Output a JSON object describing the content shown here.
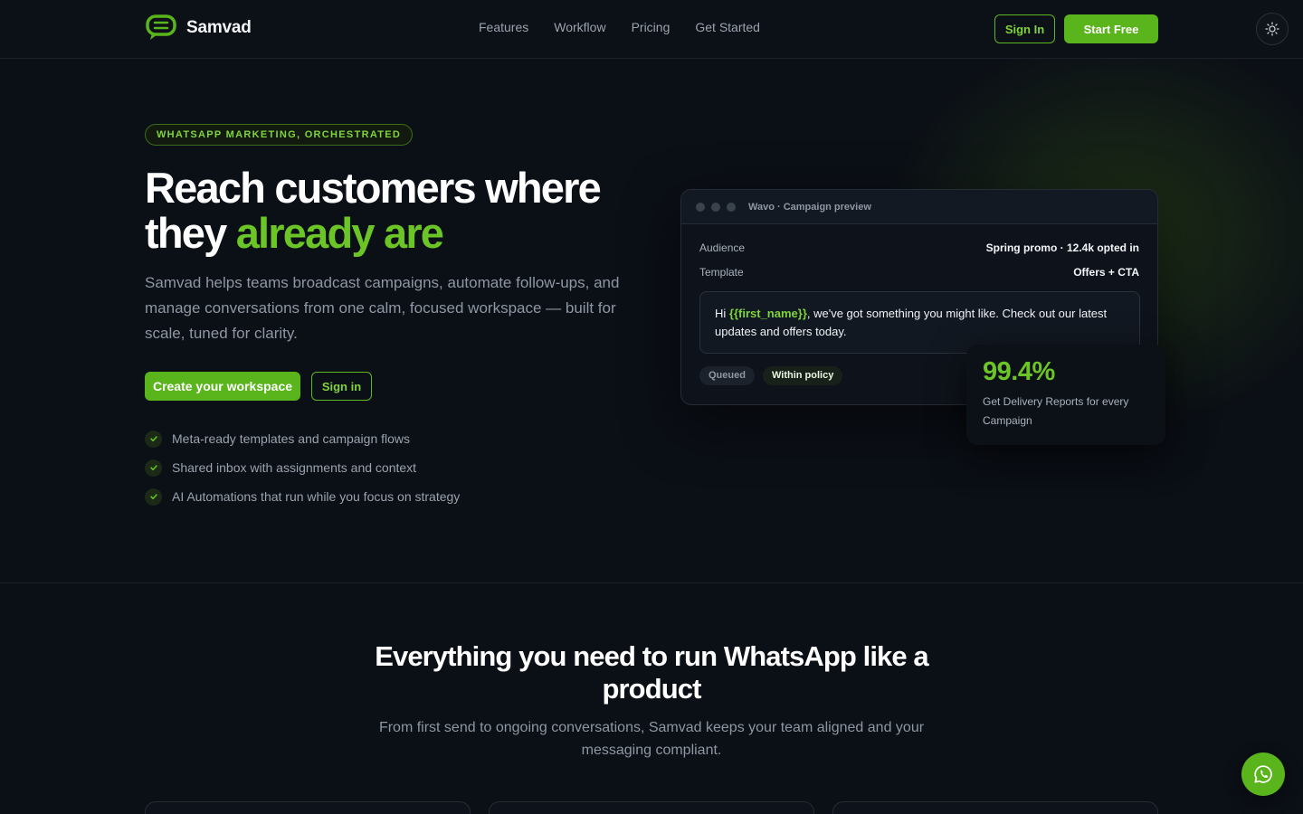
{
  "brand": {
    "name": "Samvad"
  },
  "nav": {
    "links": [
      "Features",
      "Workflow",
      "Pricing",
      "Get Started"
    ],
    "sign_in": "Sign In",
    "start_free": "Start Free"
  },
  "hero": {
    "eyebrow": "WHATSAPP MARKETING, ORCHESTRATED",
    "title_line1": "Reach customers where",
    "title_line2_plain": "they ",
    "title_line2_accent": "already are",
    "subtitle": "Samvad helps teams broadcast campaigns, automate follow-ups, and manage conversations from one calm, focused workspace — built for scale, tuned for clarity.",
    "cta_primary": "Create your workspace",
    "cta_secondary": "Sign in",
    "features": [
      "Meta-ready templates and campaign flows",
      "Shared inbox with assignments and context",
      "AI Automations that run while you focus on strategy"
    ]
  },
  "preview": {
    "window_title": "Wavo · Campaign preview",
    "audience_label": "Audience",
    "audience_value": "Spring promo · 12.4k opted in",
    "template_label": "Template",
    "template_value": "Offers + CTA",
    "message_prefix": "Hi ",
    "message_variable": "{{first_name}}",
    "message_rest": ", we've got something you might like. Check out our latest updates and offers today.",
    "tag_queued": "Queued",
    "tag_policy": "Within policy"
  },
  "stat": {
    "value": "99.4%",
    "label": "Get Delivery Reports for every Campaign"
  },
  "section2": {
    "title": "Everything you need to run WhatsApp like a product",
    "subtitle": "From first send to ongoing conversations, Samvad keeps your team aligned and your messaging compliant."
  },
  "colors": {
    "accent": "#5ab41b",
    "accent_text": "#6cc526",
    "background": "#0b0f16"
  },
  "icons": {
    "brand": "chat-bubble-logo-icon",
    "theme": "sun-icon",
    "check": "check-icon",
    "fab": "whatsapp-icon"
  }
}
